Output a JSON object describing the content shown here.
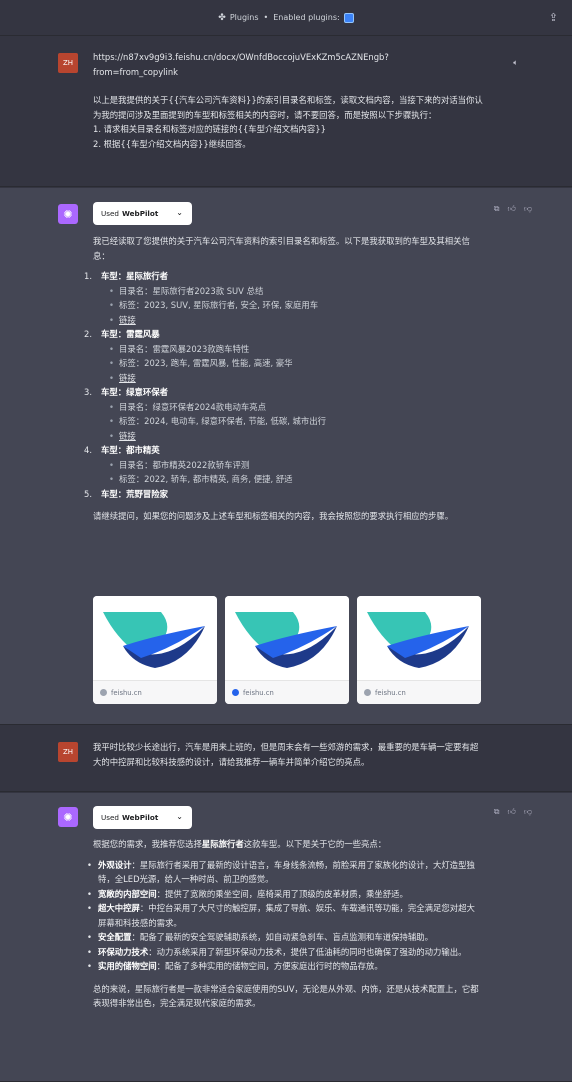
{
  "topbar": {
    "plugins_label": "Plugins",
    "separator": "•",
    "enabled_label": "Enabled plugins:"
  },
  "user1": {
    "avatar": "ZH",
    "url_line1": "https://n87xv9g9i3.feishu.cn/docx/OWnfdBoccojuVExKZm5cAZNEngb?",
    "url_line2": "from=from_copylink",
    "para1": "以上是我提供的关于{{汽车公司汽车资料}}的索引目录名和标签，读取文档内容，当接下来的对话当你认为我的提问涉及里面提到的车型和标签相关的内容时，请不要回答，而是按照以下步骤执行：",
    "step1": "1. 请求相关目录名和标签对应的链接的{{车型介绍文档内容}}",
    "step2": "2. 根据{{车型介绍文档内容}}继续回答。"
  },
  "bot1": {
    "used_prefix": "Used",
    "plugin": "WebPilot",
    "intro": "我已经读取了您提供的关于汽车公司汽车资料的索引目录名和标签。以下是我获取到的车型及其相关信息：",
    "cars": [
      {
        "num": "1.",
        "prefix": "车型：",
        "name": "星际旅行者",
        "dir": "目录名：星际旅行者2023款 SUV 总结",
        "tags": "标签：2023, SUV, 星际旅行者, 安全, 环保, 家庭用车",
        "link": "链接"
      },
      {
        "num": "2.",
        "prefix": "车型：",
        "name": "雷霆风暴",
        "dir": "目录名：雷霆风暴2023款跑车特性",
        "tags": "标签：2023, 跑车, 雷霆风暴, 性能, 高速, 豪华",
        "link": "链接"
      },
      {
        "num": "3.",
        "prefix": "车型：",
        "name": "绿意环保者",
        "dir": "目录名：绿意环保者2024款电动车亮点",
        "tags": "标签：2024, 电动车, 绿意环保者, 节能, 低碳, 城市出行",
        "link": "链接"
      },
      {
        "num": "4.",
        "prefix": "车型：",
        "name": "都市精英",
        "dir": "目录名：都市精英2022款轿车评测",
        "tags": "标签：2022, 轿车, 都市精英, 商务, 便捷, 舒适"
      },
      {
        "num": "5.",
        "prefix": "车型：",
        "name": "荒野冒险家"
      }
    ],
    "outro": "请继续提问，如果您的问题涉及上述车型和标签相关的内容，我会按照您的要求执行相应的步骤。",
    "sources": [
      "feishu.cn",
      "feishu.cn",
      "feishu.cn"
    ]
  },
  "user2": {
    "avatar": "ZH",
    "text": "我平时比较少长途出行，汽车是用来上班的，但是周末会有一些郊游的需求，最重要的是车辆一定要有超大的中控屏和比较科技感的设计，请给我推荐一辆车并简单介绍它的亮点。"
  },
  "bot2": {
    "used_prefix": "Used",
    "plugin": "WebPilot",
    "intro_a": "根据您的需求，我推荐您选择",
    "intro_b": "星际旅行者",
    "intro_c": "这款车型。以下是关于它的一些亮点：",
    "features": [
      {
        "title": "外观设计",
        "text": "：星际旅行者采用了最新的设计语言，车身线条流畅，前脸采用了家族化的设计，大灯造型独特，全LED光源，给人一种时尚、前卫的感觉。"
      },
      {
        "title": "宽敞的内部空间",
        "text": "：提供了宽敞的乘坐空间，座椅采用了顶级的皮革材质，乘坐舒适。"
      },
      {
        "title": "超大中控屏",
        "text": "：中控台采用了大尺寸的触控屏，集成了导航、娱乐、车载通讯等功能，完全满足您对超大屏幕和科技感的需求。"
      },
      {
        "title": "安全配置",
        "text": "：配备了最新的安全驾驶辅助系统，如自动紧急刹车、盲点监测和车道保持辅助。"
      },
      {
        "title": "环保动力技术",
        "text": "：动力系统采用了新型环保动力技术，提供了低油耗的同时也确保了强劲的动力输出。"
      },
      {
        "title": "实用的储物空间",
        "text": "：配备了多种实用的储物空间，方便家庭出行时的物品存放。"
      }
    ],
    "summary": "总的来说，星际旅行者是一款非常适合家庭使用的SUV，无论是从外观、内饰，还是从技术配置上，它都表现得非常出色，完全满足现代家庭的需求。"
  },
  "colors": {
    "bg_user": "#343541",
    "bg_bot": "#444654",
    "avatar_user": "#b8452f",
    "avatar_bot": "#ab68ff",
    "logo_teal": "#37c5b5",
    "logo_blue": "#2563eb",
    "logo_navy": "#1e3a8a"
  },
  "icons": [
    "plugin-icon",
    "share-icon",
    "speaker-icon",
    "copy-icon",
    "thumbs-up-icon",
    "thumbs-down-icon",
    "chevron-down-icon",
    "openai-icon"
  ]
}
